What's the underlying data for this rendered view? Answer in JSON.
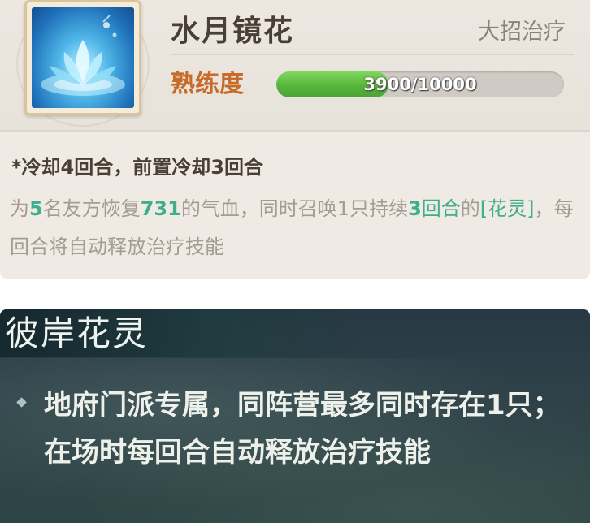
{
  "skill": {
    "name": "水月镜花",
    "type": "大招治疗",
    "proficiency_label": "熟练度",
    "proficiency_text": "3900/10000",
    "proficiency_fraction": 0.39,
    "cooldown": "*冷却4回合，前置冷却3回合",
    "description_parts": {
      "p1": "为",
      "n1": "5",
      "p2": "名友方恢复",
      "n2": "731",
      "p3": "的气血，同时召唤1只持续",
      "n3": "3",
      "p4": "回合",
      "p5": "的",
      "tag": "[花灵]",
      "p6": "，每回合将自动释放治疗技能"
    },
    "icon": "lotus-water-icon"
  },
  "spirit": {
    "title": "彼岸花灵",
    "description": "地府门派专属，同阵营最多同时存在1只；在场时每回合自动释放治疗技能",
    "bullet_icon": "diamond-bullet-icon"
  },
  "colors": {
    "accent_green": "#3fae8c",
    "proficiency_orange": "#c86a2a",
    "bar_green": "#56b63b",
    "panel_dark": "#2e4148"
  }
}
